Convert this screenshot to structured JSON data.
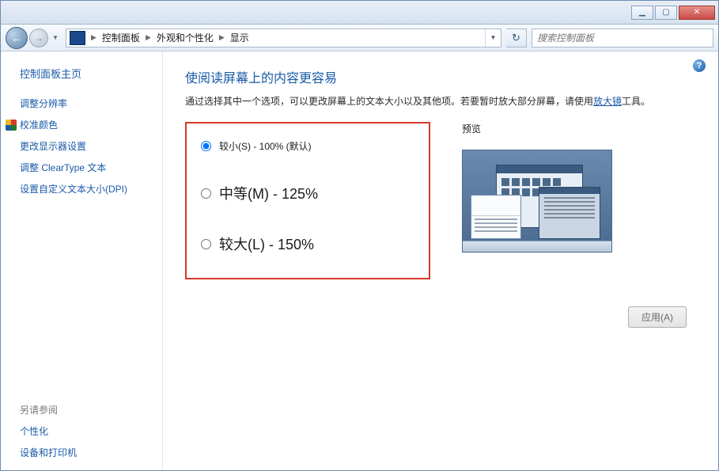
{
  "titlebar": {
    "minimize_glyph": "▁",
    "maximize_glyph": "▢",
    "close_glyph": "✕"
  },
  "nav": {
    "back_glyph": "←",
    "fwd_glyph": "→",
    "drop_glyph": "▼",
    "refresh_glyph": "↻"
  },
  "breadcrumbs": {
    "sep": "▶",
    "items": [
      "控制面板",
      "外观和个性化",
      "显示"
    ]
  },
  "search": {
    "placeholder": "搜索控制面板"
  },
  "sidebar": {
    "home": "控制面板主页",
    "links": [
      {
        "label": "调整分辨率",
        "shield": false
      },
      {
        "label": "校准颜色",
        "shield": true
      },
      {
        "label": "更改显示器设置",
        "shield": false
      },
      {
        "label": "调整 ClearType 文本",
        "shield": false
      },
      {
        "label": "设置自定义文本大小(DPI)",
        "shield": false
      }
    ],
    "see_also_title": "另请参阅",
    "see_also": [
      "个性化",
      "设备和打印机"
    ]
  },
  "main": {
    "heading": "使阅读屏幕上的内容更容易",
    "desc_before": "通过选择其中一个选项，可以更改屏幕上的文本大小以及其他项。若要暂时放大部分屏幕，请使用",
    "desc_link": "放大镜",
    "desc_after": "工具。",
    "options": [
      {
        "label": "较小(S) - 100% (默认)",
        "size": "sm",
        "checked": true
      },
      {
        "label": "中等(M) - 125%",
        "size": "lg",
        "checked": false
      },
      {
        "label": "较大(L) - 150%",
        "size": "lg",
        "checked": false
      }
    ],
    "preview_label": "预览",
    "apply_label": "应用(A)"
  },
  "help_glyph": "?"
}
